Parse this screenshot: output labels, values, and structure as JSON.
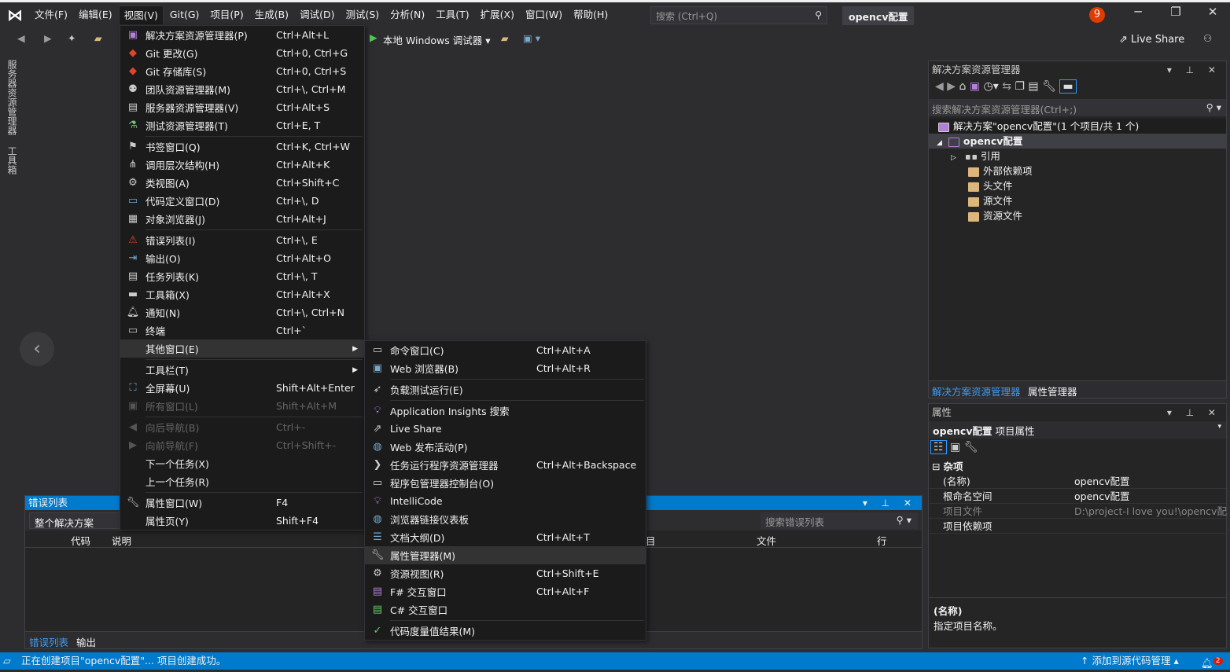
{
  "menubar": {
    "items": [
      "文件(F)",
      "编辑(E)",
      "视图(V)",
      "Git(G)",
      "项目(P)",
      "生成(B)",
      "调试(D)",
      "测试(S)",
      "分析(N)",
      "工具(T)",
      "扩展(X)",
      "窗口(W)",
      "帮助(H)"
    ],
    "open_index": 2
  },
  "search": {
    "placeholder": "搜索 (Ctrl+Q)"
  },
  "title": "opencv配置",
  "notification_count": "9",
  "toolbar": {
    "debugger": "本地 Windows 调试器"
  },
  "live_share": "Live Share",
  "left_tabs": [
    "服务器资源管理器",
    "工具箱"
  ],
  "view_menu": [
    {
      "icon": "solution-explorer-icon",
      "glyph": "▣",
      "color": "#b180d7",
      "label": "解决方案资源管理器(P)",
      "shortcut": "Ctrl+Alt+L"
    },
    {
      "icon": "git-changes-icon",
      "glyph": "◆",
      "color": "#e0442a",
      "label": "Git 更改(G)",
      "shortcut": "Ctrl+0, Ctrl+G"
    },
    {
      "icon": "git-repo-icon",
      "glyph": "◆",
      "color": "#e0442a",
      "label": "Git 存储库(S)",
      "shortcut": "Ctrl+0, Ctrl+S"
    },
    {
      "icon": "team-explorer-icon",
      "glyph": "⚉",
      "color": "#ccc",
      "label": "团队资源管理器(M)",
      "shortcut": "Ctrl+\\, Ctrl+M"
    },
    {
      "icon": "server-explorer-icon",
      "glyph": "▤",
      "color": "#ccc",
      "label": "服务器资源管理器(V)",
      "shortcut": "Ctrl+Alt+S"
    },
    {
      "icon": "test-explorer-icon",
      "glyph": "⚗",
      "color": "#6c6",
      "label": "测试资源管理器(T)",
      "shortcut": "Ctrl+E, T"
    },
    {
      "sep": true
    },
    {
      "icon": "bookmark-icon",
      "glyph": "⚑",
      "color": "#ccc",
      "label": "书签窗口(Q)",
      "shortcut": "Ctrl+K, Ctrl+W"
    },
    {
      "icon": "call-hierarchy-icon",
      "glyph": "⋔",
      "color": "#ccc",
      "label": "调用层次结构(H)",
      "shortcut": "Ctrl+Alt+K"
    },
    {
      "icon": "class-view-icon",
      "glyph": "⚙",
      "color": "#ccc",
      "label": "类视图(A)",
      "shortcut": "Ctrl+Shift+C"
    },
    {
      "icon": "code-definition-icon",
      "glyph": "▭",
      "color": "#7ac",
      "label": "代码定义窗口(D)",
      "shortcut": "Ctrl+\\, D"
    },
    {
      "icon": "object-browser-icon",
      "glyph": "▦",
      "color": "#ccc",
      "label": "对象浏览器(J)",
      "shortcut": "Ctrl+Alt+J"
    },
    {
      "sep": true
    },
    {
      "icon": "error-list-icon",
      "glyph": "⚠",
      "color": "#e0442a",
      "label": "错误列表(I)",
      "shortcut": "Ctrl+\\, E"
    },
    {
      "icon": "output-icon",
      "glyph": "⇥",
      "color": "#7ac",
      "label": "输出(O)",
      "shortcut": "Ctrl+Alt+O"
    },
    {
      "icon": "task-list-icon",
      "glyph": "▤",
      "color": "#ccc",
      "label": "任务列表(K)",
      "shortcut": "Ctrl+\\, T"
    },
    {
      "icon": "toolbox-icon",
      "glyph": "▬",
      "color": "#ccc",
      "label": "工具箱(X)",
      "shortcut": "Ctrl+Alt+X"
    },
    {
      "icon": "bell-icon",
      "glyph": "🔔︎",
      "color": "#ccc",
      "label": "通知(N)",
      "shortcut": "Ctrl+\\, Ctrl+N"
    },
    {
      "icon": "terminal-icon",
      "glyph": "▭",
      "color": "#ccc",
      "label": "终端",
      "shortcut": "Ctrl+`"
    },
    {
      "icon": "",
      "glyph": "",
      "label": "其他窗口(E)",
      "shortcut": "",
      "submenu": true,
      "highlight": true
    },
    {
      "sep": true
    },
    {
      "icon": "",
      "glyph": "",
      "label": "工具栏(T)",
      "shortcut": "",
      "submenu": true
    },
    {
      "icon": "fullscreen-icon",
      "glyph": "⛶",
      "color": "#7ac",
      "label": "全屏幕(U)",
      "shortcut": "Shift+Alt+Enter"
    },
    {
      "icon": "all-windows-icon",
      "glyph": "▣",
      "color": "#555",
      "label": "所有窗口(L)",
      "shortcut": "Shift+Alt+M",
      "disabled": true
    },
    {
      "sep": true
    },
    {
      "icon": "nav-back-icon",
      "glyph": "◀",
      "color": "#555",
      "label": "向后导航(B)",
      "shortcut": "Ctrl+-",
      "disabled": true
    },
    {
      "icon": "nav-forward-icon",
      "glyph": "▶",
      "color": "#555",
      "label": "向前导航(F)",
      "shortcut": "Ctrl+Shift+-",
      "disabled": true
    },
    {
      "icon": "",
      "glyph": "",
      "label": "下一个任务(X)",
      "shortcut": ""
    },
    {
      "icon": "",
      "glyph": "",
      "label": "上一个任务(R)",
      "shortcut": ""
    },
    {
      "sep": true
    },
    {
      "icon": "wrench-icon",
      "glyph": "🔧︎",
      "color": "#ccc",
      "label": "属性窗口(W)",
      "shortcut": "F4"
    },
    {
      "icon": "",
      "glyph": "",
      "label": "属性页(Y)",
      "shortcut": "Shift+F4"
    }
  ],
  "other_windows_menu": [
    {
      "icon": "command-window-icon",
      "glyph": "▭",
      "color": "#ccc",
      "label": "命令窗口(C)",
      "shortcut": "Ctrl+Alt+A"
    },
    {
      "icon": "web-browser-icon",
      "glyph": "▣",
      "color": "#7ac",
      "label": "Web 浏览器(B)",
      "shortcut": "Ctrl+Alt+R"
    },
    {
      "sep": true
    },
    {
      "icon": "load-test-icon",
      "glyph": "➶",
      "color": "#ccc",
      "label": "负载测试运行(E)",
      "shortcut": ""
    },
    {
      "sep": true
    },
    {
      "icon": "app-insights-icon",
      "glyph": "💡︎",
      "color": "#b180d7",
      "label": "Application Insights 搜索",
      "shortcut": ""
    },
    {
      "icon": "live-share-icon",
      "glyph": "⇗",
      "color": "#ccc",
      "label": "Live Share",
      "shortcut": ""
    },
    {
      "icon": "web-publish-icon",
      "glyph": "◍",
      "color": "#7ac",
      "label": "Web 发布活动(P)",
      "shortcut": ""
    },
    {
      "icon": "task-runner-icon",
      "glyph": "❯",
      "color": "#ccc",
      "label": "任务运行程序资源管理器",
      "shortcut": "Ctrl+Alt+Backspace"
    },
    {
      "icon": "package-console-icon",
      "glyph": "▭",
      "color": "#ccc",
      "label": "程序包管理器控制台(O)",
      "shortcut": ""
    },
    {
      "icon": "intellicode-icon",
      "glyph": "💡︎",
      "color": "#b180d7",
      "label": "IntelliCode",
      "shortcut": ""
    },
    {
      "icon": "browser-link-icon",
      "glyph": "◍",
      "color": "#7ac",
      "label": "浏览器链接仪表板",
      "shortcut": ""
    },
    {
      "icon": "document-outline-icon",
      "glyph": "☰",
      "color": "#7ac",
      "label": "文档大纲(D)",
      "shortcut": "Ctrl+Alt+T"
    },
    {
      "icon": "wrench-icon",
      "glyph": "🔧︎",
      "color": "#ccc",
      "label": "属性管理器(M)",
      "shortcut": "",
      "highlight": true
    },
    {
      "icon": "resource-view-icon",
      "glyph": "⚙",
      "color": "#ccc",
      "label": "资源视图(R)",
      "shortcut": "Ctrl+Shift+E"
    },
    {
      "icon": "fsharp-icon",
      "glyph": "▤",
      "color": "#b180d7",
      "label": "F# 交互窗口",
      "shortcut": "Ctrl+Alt+F"
    },
    {
      "icon": "csharp-icon",
      "glyph": "▤",
      "color": "#6c6",
      "label": "C# 交互窗口",
      "shortcut": ""
    },
    {
      "sep": true
    },
    {
      "icon": "code-metrics-icon",
      "glyph": "✓",
      "color": "#6c6",
      "label": "代码度量值结果(M)",
      "shortcut": ""
    }
  ],
  "error_list": {
    "title": "错误列表",
    "scope": "整个解决方案",
    "search_placeholder": "搜索错误列表",
    "columns": [
      "代码",
      "说明",
      "目",
      "文件",
      "行"
    ],
    "tabs": [
      "错误列表",
      "输出"
    ]
  },
  "solution_explorer": {
    "title": "解决方案资源管理器",
    "search_placeholder": "搜索解决方案资源管理器(Ctrl+;)",
    "solution": "解决方案\"opencv配置\"(1 个项目/共 1 个)",
    "project": "opencv配置",
    "items": [
      "引用",
      "外部依赖项",
      "头文件",
      "源文件",
      "资源文件"
    ],
    "tabs": [
      "解决方案资源管理器",
      "属性管理器"
    ]
  },
  "properties": {
    "title": "属性",
    "object": "opencv配置",
    "object_type": "项目属性",
    "category": "杂项",
    "rows": [
      {
        "k": "(名称)",
        "v": "opencv配置"
      },
      {
        "k": "根命名空间",
        "v": "opencv配置"
      },
      {
        "k": "项目文件",
        "v": "D:\\project-I love you!\\opencv配置",
        "dim": true
      },
      {
        "k": "项目依赖项",
        "v": ""
      }
    ],
    "desc_title": "(名称)",
    "desc_text": "指定项目名称。"
  },
  "status": {
    "message": "正在创建项目\"opencv配置\"... 项目创建成功。",
    "source_control": "添加到源代码管理",
    "bell_count": "2"
  },
  "colors": {
    "accent": "#007acc",
    "background": "#2d2d30",
    "menu": "#1b1b1c"
  }
}
